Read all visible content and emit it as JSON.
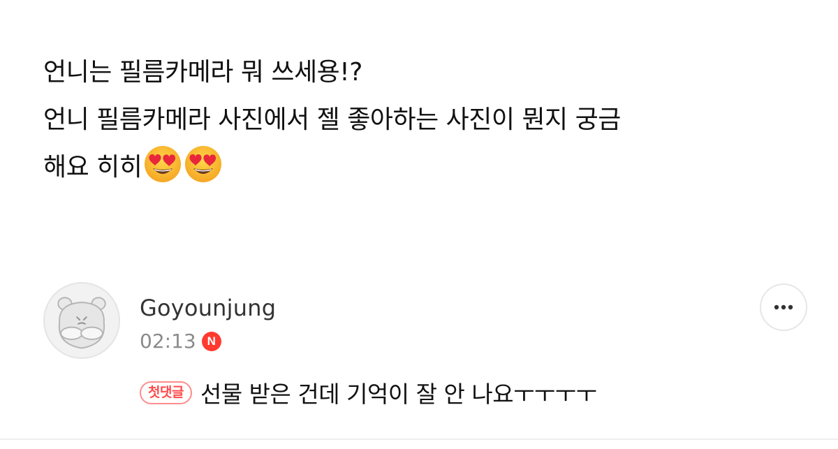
{
  "post": {
    "lines": [
      "언니는 필름카메라 뭐 쓰세용!?",
      "언니 필름카메라 사진에서 젤 좋아하는 사진이 뭔지 궁금",
      "해요 히히"
    ],
    "emojis": [
      "heart-eyes-emoji",
      "heart-eyes-emoji"
    ]
  },
  "comment": {
    "avatar_icon": "hamster-avatar-icon",
    "username": "Goyounjung",
    "time": "02:13",
    "new_badge": "N",
    "first_comment_badge": "첫댓글",
    "text": "선물 받은 건데 기억이 잘 안 나요ㅜㅜㅜㅜ",
    "more_icon": "more-horizontal-icon"
  },
  "colors": {
    "text": "#111111",
    "username": "#333333",
    "meta": "#8a8a8a",
    "badge_red": "#ff3b30",
    "first_badge": "#ff4b4b"
  }
}
